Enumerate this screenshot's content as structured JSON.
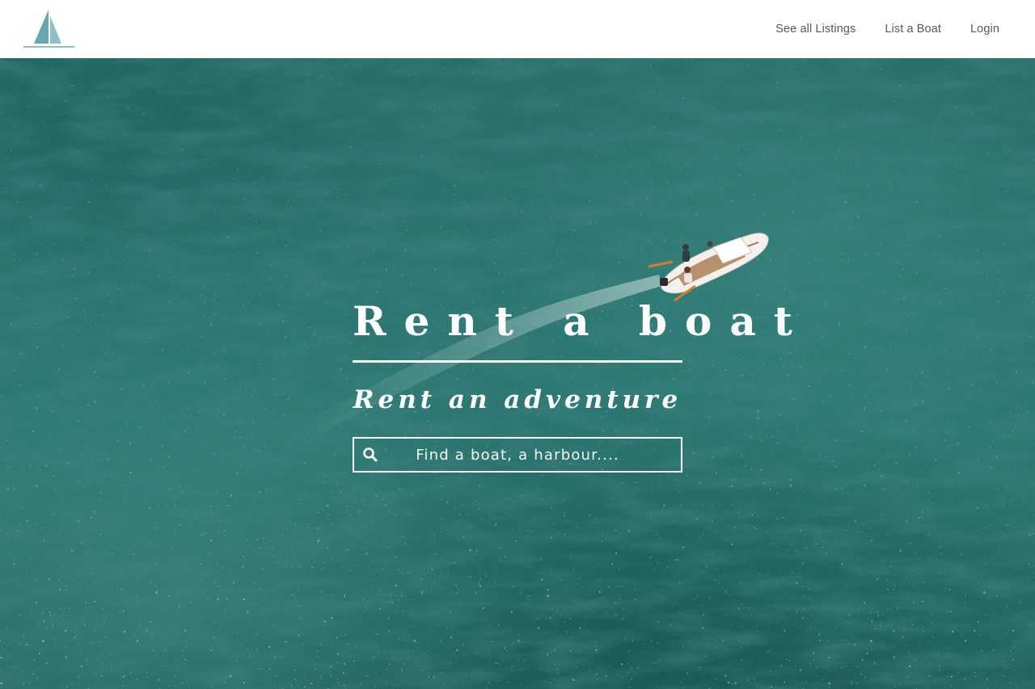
{
  "header": {
    "logo": {
      "icon": "sailboat-icon",
      "color": "#6aa7b4"
    },
    "nav": [
      {
        "label": "See all Listings"
      },
      {
        "label": "List a Boat"
      },
      {
        "label": "Login"
      }
    ]
  },
  "hero": {
    "title": "Rent a boat",
    "subtitle": "Rent an adventure",
    "search": {
      "icon": "search-icon",
      "placeholder": "Find a boat, a harbour....",
      "value": ""
    }
  },
  "colors": {
    "nav_text": "#555b5d",
    "water": "#2b7670",
    "overlay_text": "#ffffff"
  }
}
